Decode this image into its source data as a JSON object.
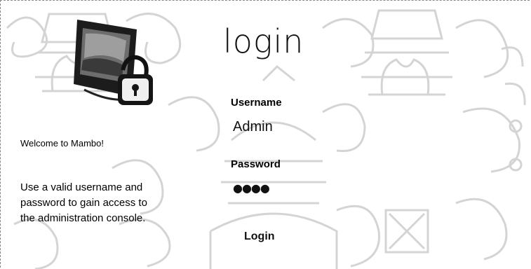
{
  "page": {
    "title": "login"
  },
  "sidebar": {
    "welcome": "Welcome to Mambo!",
    "info_lines": [
      "Use a valid username and",
      "password to gain access to",
      "the administration console."
    ]
  },
  "form": {
    "username_label": "Username",
    "username_value": "Admin",
    "password_label": "Password",
    "password_value": "●●●●",
    "login_label": "Login"
  },
  "icons": {
    "computer": "computer-lock-icon",
    "background": "thai-emblem-watermark"
  },
  "colors": {
    "watermark": "#d8d8d8",
    "text": "#111111",
    "background": "#ffffff"
  }
}
